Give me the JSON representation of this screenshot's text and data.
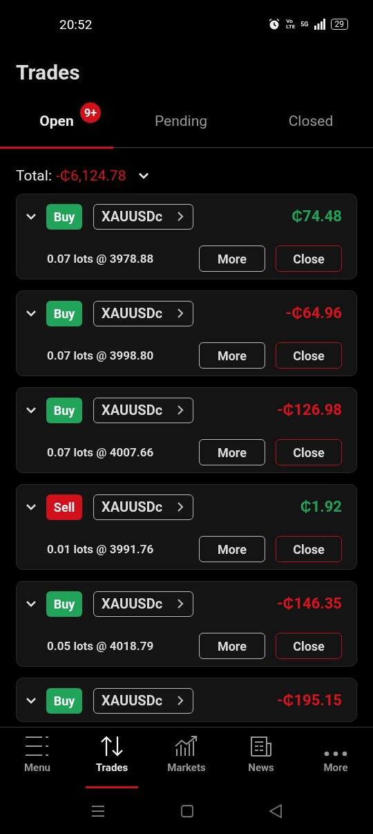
{
  "status_bar": {
    "time": "20:52",
    "volte_top": "Vo",
    "volte_bottom": "LTE",
    "network": "5G",
    "battery": "29"
  },
  "title": "Trades",
  "tabs": [
    {
      "label": "Open",
      "selected": true,
      "badge": "9+"
    },
    {
      "label": "Pending",
      "selected": false
    },
    {
      "label": "Closed",
      "selected": false
    }
  ],
  "total": {
    "label": "Total:",
    "value": "-₵6,124.78",
    "positive": false
  },
  "trades": [
    {
      "kind": "buy",
      "side_label": "Buy",
      "symbol": "XAUUSDc",
      "pnl": "₵74.48",
      "positive": true,
      "lots": "0.07 lots @ 3978.88",
      "more": "More",
      "close": "Close"
    },
    {
      "kind": "buy",
      "side_label": "Buy",
      "symbol": "XAUUSDc",
      "pnl": "-₵64.96",
      "positive": false,
      "lots": "0.07 lots @ 3998.80",
      "more": "More",
      "close": "Close"
    },
    {
      "kind": "buy",
      "side_label": "Buy",
      "symbol": "XAUUSDc",
      "pnl": "-₵126.98",
      "positive": false,
      "lots": "0.07 lots @ 4007.66",
      "more": "More",
      "close": "Close"
    },
    {
      "kind": "sell",
      "side_label": "Sell",
      "symbol": "XAUUSDc",
      "pnl": "₵1.92",
      "positive": true,
      "lots": "0.01 lots @ 3991.76",
      "more": "More",
      "close": "Close"
    },
    {
      "kind": "buy",
      "side_label": "Buy",
      "symbol": "XAUUSDc",
      "pnl": "-₵146.35",
      "positive": false,
      "lots": "0.05 lots @ 4018.79",
      "more": "More",
      "close": "Close"
    },
    {
      "kind": "buy",
      "side_label": "Buy",
      "symbol": "XAUUSDc",
      "pnl": "-₵195.15",
      "positive": false
    }
  ],
  "nav": [
    {
      "kind": "menu",
      "label": "Menu",
      "selected": false
    },
    {
      "kind": "trades",
      "label": "Trades",
      "selected": true
    },
    {
      "kind": "markets",
      "label": "Markets",
      "selected": false
    },
    {
      "kind": "news",
      "label": "News",
      "selected": false
    },
    {
      "kind": "more",
      "label": "More",
      "selected": false
    }
  ]
}
